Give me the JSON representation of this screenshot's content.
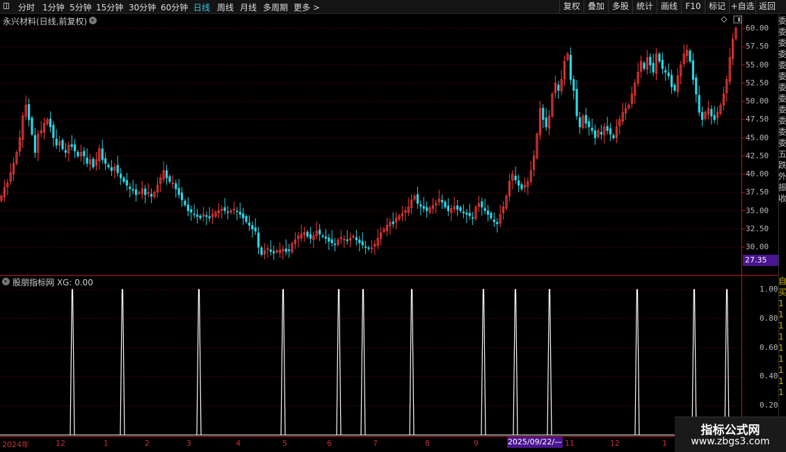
{
  "toolbar": {
    "periods": [
      "分时",
      "1分钟",
      "5分钟",
      "15分钟",
      "30分钟",
      "60分钟",
      "日线",
      "周线",
      "月线",
      "多周期",
      "更多 >"
    ],
    "active_period": "日线",
    "right_buttons": [
      "复权",
      "叠加",
      "多股",
      "统计",
      "画线",
      "F10",
      "标记",
      "+自选",
      "返回"
    ]
  },
  "main_panel": {
    "title": "永兴材料(日线,前复权)",
    "price_ticks": [
      "60.00",
      "57.50",
      "55.00",
      "52.50",
      "50.00",
      "47.50",
      "45.00",
      "42.50",
      "40.00",
      "37.50",
      "35.00",
      "32.50",
      "30.00"
    ],
    "current_price": "27.35"
  },
  "indicator_panel": {
    "title": "股朋指标网 XG: 0.00",
    "ticks": [
      "1.00",
      "0.80",
      "0.60",
      "0.40",
      "0.20"
    ]
  },
  "time_axis": {
    "labels": [
      "2024年",
      "12",
      "1",
      "2",
      "3",
      "4",
      "5",
      "6",
      "7",
      "8",
      "9",
      "11",
      "12",
      "1"
    ],
    "cursor_date": "2025/09/22/—"
  },
  "right_column": {
    "top_text": "委\n委\n委\n委\n委\n委\n委\n委\n委\n委\n委\n委\n五\n跌\n外\n振\n收",
    "bottom_text": "自\n买\n1\n1\n1\n1\n1\n1\n1\n1\n1"
  },
  "watermark": {
    "line1": "指标公式网",
    "line2": "www.zbgs3.com"
  },
  "colors": {
    "up": "#ff3c3c",
    "down": "#28d7e6",
    "grid": "#7a1010",
    "axis": "#b41e1e",
    "signal": "#ffffff"
  },
  "chart_data": {
    "type": "candlestick",
    "price_axis": [
      30,
      60
    ],
    "price_tick_step": 2.5,
    "closes": [
      37.0,
      38.2,
      38.8,
      40.2,
      41.5,
      43.0,
      45.0,
      48.0,
      49.5,
      47.5,
      45.5,
      43.0,
      45.5,
      46.0,
      47.0,
      47.5,
      46.5,
      45.0,
      44.0,
      44.5,
      43.5,
      43.0,
      44.0,
      43.8,
      43.2,
      42.5,
      43.0,
      42.5,
      41.5,
      42.0,
      41.0,
      42.0,
      43.5,
      42.0,
      41.5,
      41.0,
      40.5,
      41.0,
      40.2,
      39.5,
      39.0,
      38.5,
      38.0,
      37.8,
      37.2,
      37.5,
      38.0,
      37.2,
      37.5,
      37.0,
      37.5,
      38.5,
      39.5,
      40.5,
      39.5,
      39.0,
      38.8,
      38.0,
      37.2,
      36.5,
      35.8,
      35.0,
      34.8,
      34.5,
      34.2,
      34.0,
      34.5,
      34.2,
      34.0,
      34.5,
      34.8,
      35.0,
      35.2,
      35.0,
      34.8,
      35.0,
      35.2,
      34.9,
      34.5,
      34.0,
      33.5,
      33.0,
      32.5,
      32.2,
      30.0,
      29.0,
      29.5,
      29.8,
      29.4,
      29.2,
      29.5,
      29.6,
      29.7,
      29.4,
      29.5,
      30.5,
      31.0,
      31.5,
      31.8,
      32.0,
      31.5,
      31.2,
      31.6,
      32.2,
      31.8,
      31.5,
      31.2,
      30.8,
      30.6,
      30.4,
      31.0,
      31.3,
      31.1,
      30.9,
      31.2,
      31.5,
      31.0,
      30.6,
      30.3,
      30.0,
      29.8,
      29.9,
      30.4,
      31.2,
      32.0,
      32.5,
      33.0,
      33.4,
      33.2,
      34.0,
      34.3,
      34.6,
      35.0,
      35.5,
      36.5,
      37.0,
      36.0,
      35.6,
      35.3,
      35.0,
      35.4,
      35.7,
      36.0,
      36.6,
      36.2,
      35.5,
      35.0,
      35.3,
      35.6,
      35.2,
      35.0,
      34.7,
      34.5,
      34.3,
      34.0,
      35.5,
      36.0,
      35.5,
      35.0,
      34.5,
      34.0,
      33.5,
      33.2,
      34.5,
      35.5,
      37.0,
      39.0,
      40.0,
      39.2,
      38.5,
      38.0,
      38.5,
      39.0,
      40.5,
      42.5,
      45.5,
      49.0,
      47.5,
      46.5,
      48.0,
      51.0,
      52.5,
      51.5,
      53.0,
      55.5,
      56.5,
      53.0,
      51.5,
      48.0,
      46.5,
      48.0,
      47.0,
      46.5,
      46.0,
      45.0,
      46.0,
      45.5,
      46.5,
      46.0,
      45.5,
      45.0,
      46.5,
      47.5,
      48.5,
      49.0,
      49.5,
      51.0,
      52.5,
      54.0,
      55.5,
      54.5,
      56.0,
      55.0,
      54.0,
      56.5,
      55.5,
      54.5,
      54.0,
      53.5,
      52.0,
      51.5,
      53.5,
      55.0,
      56.5,
      57.0,
      55.5,
      53.0,
      51.0,
      48.5,
      47.5,
      48.5,
      49.0,
      48.0,
      47.5,
      48.5,
      49.5,
      51.0,
      53.0,
      56.0,
      58.5,
      60.0
    ],
    "signal_indices": [
      13,
      23,
      37,
      53,
      62,
      72,
      77,
      89,
      96,
      104,
      117,
      124
    ],
    "signal_values": [
      1,
      0
    ]
  }
}
